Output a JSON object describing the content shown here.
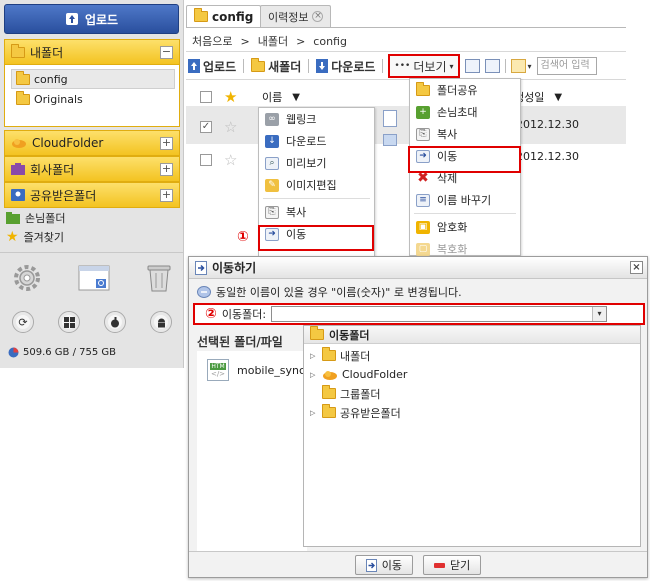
{
  "sidebar": {
    "upload_label": "업로드",
    "my_folder": {
      "label": "내폴더",
      "toggle": "−",
      "items": [
        "config",
        "Originals"
      ]
    },
    "panels": [
      {
        "label": "CloudFolder",
        "toggle": "+"
      },
      {
        "label": "회사폴더",
        "toggle": "+"
      },
      {
        "label": "공유받은폴더",
        "toggle": "+"
      }
    ],
    "guest_folder": "손님폴더",
    "favorites": "즐겨찾기",
    "storage": "509.6 GB / 755 GB"
  },
  "tabs": [
    {
      "label": "config"
    },
    {
      "label": "이력정보",
      "close": "×"
    }
  ],
  "breadcrumb": [
    "처음으로",
    ">",
    "내폴더",
    ">",
    "config"
  ],
  "toolbar": {
    "upload": "업로드",
    "new_folder": "새폴더",
    "download": "다운로드",
    "more": "더보기",
    "more_dots": "•••",
    "search_placeholder": "검색어 입력"
  },
  "file_list": {
    "col_name": "이름",
    "col_date": "생성일",
    "sort_arrow": "▼",
    "dates": [
      "2012.12.30",
      "2012.12.30"
    ]
  },
  "context_menu_left": {
    "items": [
      "웹링크",
      "다운로드",
      "미리보기",
      "이미지편집",
      "복사",
      "이동"
    ]
  },
  "context_menu_right": {
    "items": [
      "폴더공유",
      "손님초대",
      "복사",
      "이동",
      "삭제",
      "이름 바꾸기",
      "암호화",
      "복호화"
    ]
  },
  "annotations": {
    "one": "①",
    "two": "②"
  },
  "dialog": {
    "title": "이동하기",
    "close": "×",
    "notice": "동일한 이름이 있을 경우 \"이름(숫자)\" 로 변경됩니다.",
    "dest_label": "이동폴더:",
    "dest_arrow": "▾",
    "selected_header": "선택된 폴더/파일",
    "selected_file": "mobile_sync",
    "file_badge": "HTM",
    "tree_header": "이동폴더",
    "tree": [
      "내폴더",
      "CloudFolder",
      "그룹폴더",
      "공유받은폴더"
    ],
    "move_button": "이동",
    "close_button": "닫기"
  },
  "colors": {
    "accent_red": "#e00000",
    "panel_yellow": "#f3c321",
    "upload_blue": "#2a4f9e"
  }
}
